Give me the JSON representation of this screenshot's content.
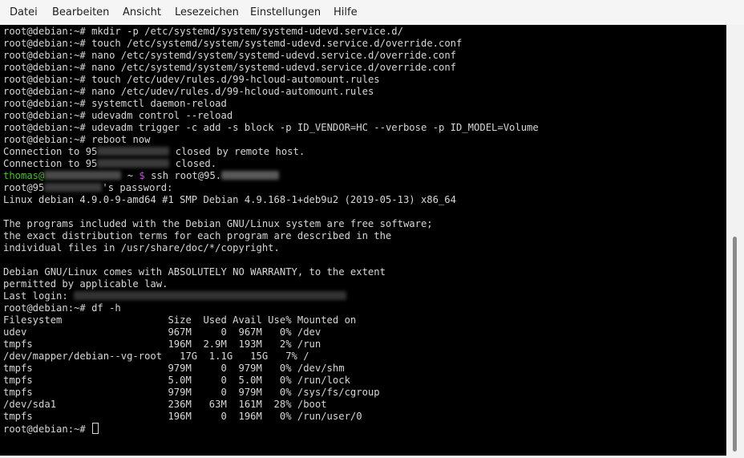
{
  "menu": [
    "Datei",
    "Bearbeiten",
    "Ansicht",
    "Lesezeichen",
    "Einstellungen",
    "Hilfe"
  ],
  "prompt": "root@debian:~#",
  "commands": [
    "mkdir -p /etc/systemd/system/systemd-udevd.service.d/",
    "touch /etc/systemd/system/systemd-udevd.service.d/override.conf",
    "nano /etc/systemd/system/systemd-udevd.service.d/override.conf",
    "nano /etc/systemd/system/systemd-udevd.service.d/override.conf",
    "touch /etc/udev/rules.d/99-hcloud-automount.rules",
    "nano /etc/udev/rules.d/99-hcloud-automount.rules",
    "systemctl daemon-reload",
    "udevadm control --reload",
    "udevadm trigger -c add -s block -p ID_VENDOR=HC --verbose -p ID_MODEL=Volume",
    "reboot now"
  ],
  "conn1": {
    "pre": "Connection to 95",
    "post": "closed by remote host."
  },
  "conn2": {
    "pre": "Connection to 95",
    "post": "closed."
  },
  "local": {
    "user": "thomas@",
    "tilde": " ~ ",
    "dollar": "$",
    "cmd": " ssh root@95."
  },
  "pw": {
    "pre": "root@95",
    "post": "'s password:"
  },
  "motd": [
    "Linux debian 4.9.0-9-amd64 #1 SMP Debian 4.9.168-1+deb9u2 (2019-05-13) x86_64",
    "",
    "The programs included with the Debian GNU/Linux system are free software;",
    "the exact distribution terms for each program are described in the",
    "individual files in /usr/share/doc/*/copyright.",
    "",
    "Debian GNU/Linux comes with ABSOLUTELY NO WARRANTY, to the extent",
    "permitted by applicable law."
  ],
  "last_login": "Last login:",
  "df_cmd": "df -h",
  "df": [
    "Filesystem                  Size  Used Avail Use% Mounted on",
    "udev                        967M     0  967M   0% /dev",
    "tmpfs                       196M  2.9M  193M   2% /run",
    "/dev/mapper/debian--vg-root   17G  1.1G   15G   7% /",
    "tmpfs                       979M     0  979M   0% /dev/shm",
    "tmpfs                       5.0M     0  5.0M   0% /run/lock",
    "tmpfs                       979M     0  979M   0% /sys/fs/cgroup",
    "/dev/sda1                   236M   63M  161M  28% /boot",
    "tmpfs                       196M     0  196M   0% /run/user/0"
  ],
  "colors": {
    "background": "#000000",
    "text": "#d6d6d6",
    "user": "#4fbf2c",
    "dollar": "#c84fd8"
  }
}
